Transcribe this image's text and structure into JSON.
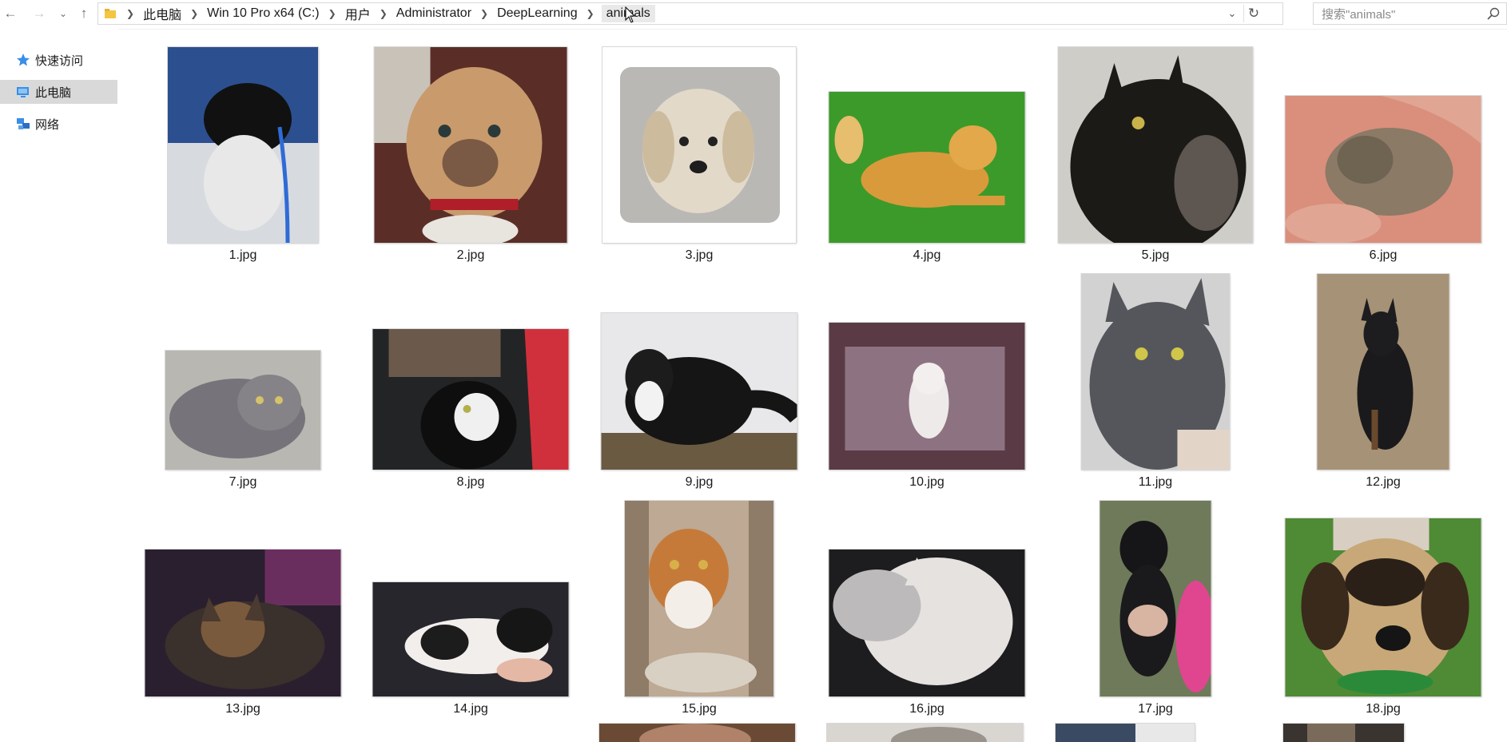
{
  "address": {
    "breadcrumbs": [
      "此电脑",
      "Win 10 Pro x64 (C:)",
      "用户",
      "Administrator",
      "DeepLearning",
      "animals"
    ],
    "nav_icons": [
      "back-arrow-icon",
      "forward-arrow-icon",
      "recent-dropdown-icon",
      "up-arrow-icon"
    ]
  },
  "search": {
    "placeholder": "搜索\"animals\""
  },
  "sidebar": {
    "items": [
      {
        "label": "快速访问",
        "icon": "star-icon",
        "selected": false
      },
      {
        "label": "此电脑",
        "icon": "computer-icon",
        "selected": true
      },
      {
        "label": "网络",
        "icon": "network-icon",
        "selected": false
      }
    ]
  },
  "files": [
    {
      "name": "1.jpg",
      "subject": "black-and-white dog held by person"
    },
    {
      "name": "2.jpg",
      "subject": "tan pit bull with red collar"
    },
    {
      "name": "3.jpg",
      "subject": "light cream fluffy dog"
    },
    {
      "name": "4.jpg",
      "subject": "orange dog lying on grass"
    },
    {
      "name": "5.jpg",
      "subject": "black cat in profile"
    },
    {
      "name": "6.jpg",
      "subject": "tabby kitten held in hands"
    },
    {
      "name": "7.jpg",
      "subject": "gray long-haired cat lying down"
    },
    {
      "name": "8.jpg",
      "subject": "black-and-white kitten"
    },
    {
      "name": "9.jpg",
      "subject": "black-and-white fluffy cat"
    },
    {
      "name": "10.jpg",
      "subject": "white kitten on floor"
    },
    {
      "name": "11.jpg",
      "subject": "gray cat portrait"
    },
    {
      "name": "12.jpg",
      "subject": "black shepherd dog sitting in field"
    },
    {
      "name": "13.jpg",
      "subject": "tortoiseshell cat"
    },
    {
      "name": "14.jpg",
      "subject": "white-and-black cat held"
    },
    {
      "name": "15.jpg",
      "subject": "orange tabby on cat tree"
    },
    {
      "name": "16.jpg",
      "subject": "two white cats cuddling"
    },
    {
      "name": "17.jpg",
      "subject": "black puppy held up"
    },
    {
      "name": "18.jpg",
      "subject": "tricolor puppy face"
    },
    {
      "name": "",
      "subject": "partially visible thumbnail"
    },
    {
      "name": "",
      "subject": "partially visible thumbnail"
    },
    {
      "name": "",
      "subject": "partially visible thumbnail"
    },
    {
      "name": "",
      "subject": "partially visible thumbnail"
    }
  ]
}
